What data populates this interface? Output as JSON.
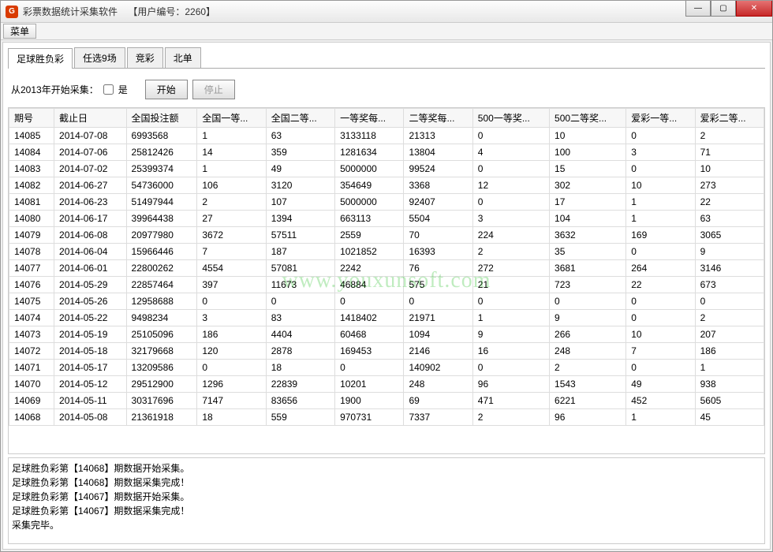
{
  "titlebar": {
    "icon_letter": "G",
    "app_title": "彩票数据统计采集软件",
    "user_label": "【用户编号：2260】"
  },
  "win_controls": {
    "min": "—",
    "max": "▢",
    "close": "✕"
  },
  "menubar": {
    "menu": "菜单"
  },
  "tabs": [
    {
      "label": "足球胜负彩",
      "active": true
    },
    {
      "label": "任选9场",
      "active": false
    },
    {
      "label": "竞彩",
      "active": false
    },
    {
      "label": "北单",
      "active": false
    }
  ],
  "controls": {
    "label": "从2013年开始采集：",
    "yes": "是",
    "start": "开始",
    "stop": "停止"
  },
  "columns": [
    "期号",
    "截止日",
    "全国投注额",
    "全国一等...",
    "全国二等...",
    "一等奖每...",
    "二等奖每...",
    "500一等奖...",
    "500二等奖...",
    "爱彩一等...",
    "爱彩二等..."
  ],
  "rows": [
    [
      "14085",
      "2014-07-08",
      "6993568",
      "1",
      "63",
      "3133118",
      "21313",
      "0",
      "10",
      "0",
      "2"
    ],
    [
      "14084",
      "2014-07-06",
      "25812426",
      "14",
      "359",
      "1281634",
      "13804",
      "4",
      "100",
      "3",
      "71"
    ],
    [
      "14083",
      "2014-07-02",
      "25399374",
      "1",
      "49",
      "5000000",
      "99524",
      "0",
      "15",
      "0",
      "10"
    ],
    [
      "14082",
      "2014-06-27",
      "54736000",
      "106",
      "3120",
      "354649",
      "3368",
      "12",
      "302",
      "10",
      "273"
    ],
    [
      "14081",
      "2014-06-23",
      "51497944",
      "2",
      "107",
      "5000000",
      "92407",
      "0",
      "17",
      "1",
      "22"
    ],
    [
      "14080",
      "2014-06-17",
      "39964438",
      "27",
      "1394",
      "663113",
      "5504",
      "3",
      "104",
      "1",
      "63"
    ],
    [
      "14079",
      "2014-06-08",
      "20977980",
      "3672",
      "57511",
      "2559",
      "70",
      "224",
      "3632",
      "169",
      "3065"
    ],
    [
      "14078",
      "2014-06-04",
      "15966446",
      "7",
      "187",
      "1021852",
      "16393",
      "2",
      "35",
      "0",
      "9"
    ],
    [
      "14077",
      "2014-06-01",
      "22800262",
      "4554",
      "57081",
      "2242",
      "76",
      "272",
      "3681",
      "264",
      "3146"
    ],
    [
      "14076",
      "2014-05-29",
      "22857464",
      "397",
      "11673",
      "46884",
      "575",
      "21",
      "723",
      "22",
      "673"
    ],
    [
      "14075",
      "2014-05-26",
      "12958688",
      "0",
      "0",
      "0",
      "0",
      "0",
      "0",
      "0",
      "0"
    ],
    [
      "14074",
      "2014-05-22",
      "9498234",
      "3",
      "83",
      "1418402",
      "21971",
      "1",
      "9",
      "0",
      "2"
    ],
    [
      "14073",
      "2014-05-19",
      "25105096",
      "186",
      "4404",
      "60468",
      "1094",
      "9",
      "266",
      "10",
      "207"
    ],
    [
      "14072",
      "2014-05-18",
      "32179668",
      "120",
      "2878",
      "169453",
      "2146",
      "16",
      "248",
      "7",
      "186"
    ],
    [
      "14071",
      "2014-05-17",
      "13209586",
      "0",
      "18",
      "0",
      "140902",
      "0",
      "2",
      "0",
      "1"
    ],
    [
      "14070",
      "2014-05-12",
      "29512900",
      "1296",
      "22839",
      "10201",
      "248",
      "96",
      "1543",
      "49",
      "938"
    ],
    [
      "14069",
      "2014-05-11",
      "30317696",
      "7147",
      "83656",
      "1900",
      "69",
      "471",
      "6221",
      "452",
      "5605"
    ],
    [
      "14068",
      "2014-05-08",
      "21361918",
      "18",
      "559",
      "970731",
      "7337",
      "2",
      "96",
      "1",
      "45"
    ]
  ],
  "watermark": "www.youxunsoft.com",
  "log": "足球胜负彩第【14068】期数据开始采集。\n足球胜负彩第【14068】期数据采集完成！\n足球胜负彩第【14067】期数据开始采集。\n足球胜负彩第【14067】期数据采集完成！\n采集完毕。"
}
